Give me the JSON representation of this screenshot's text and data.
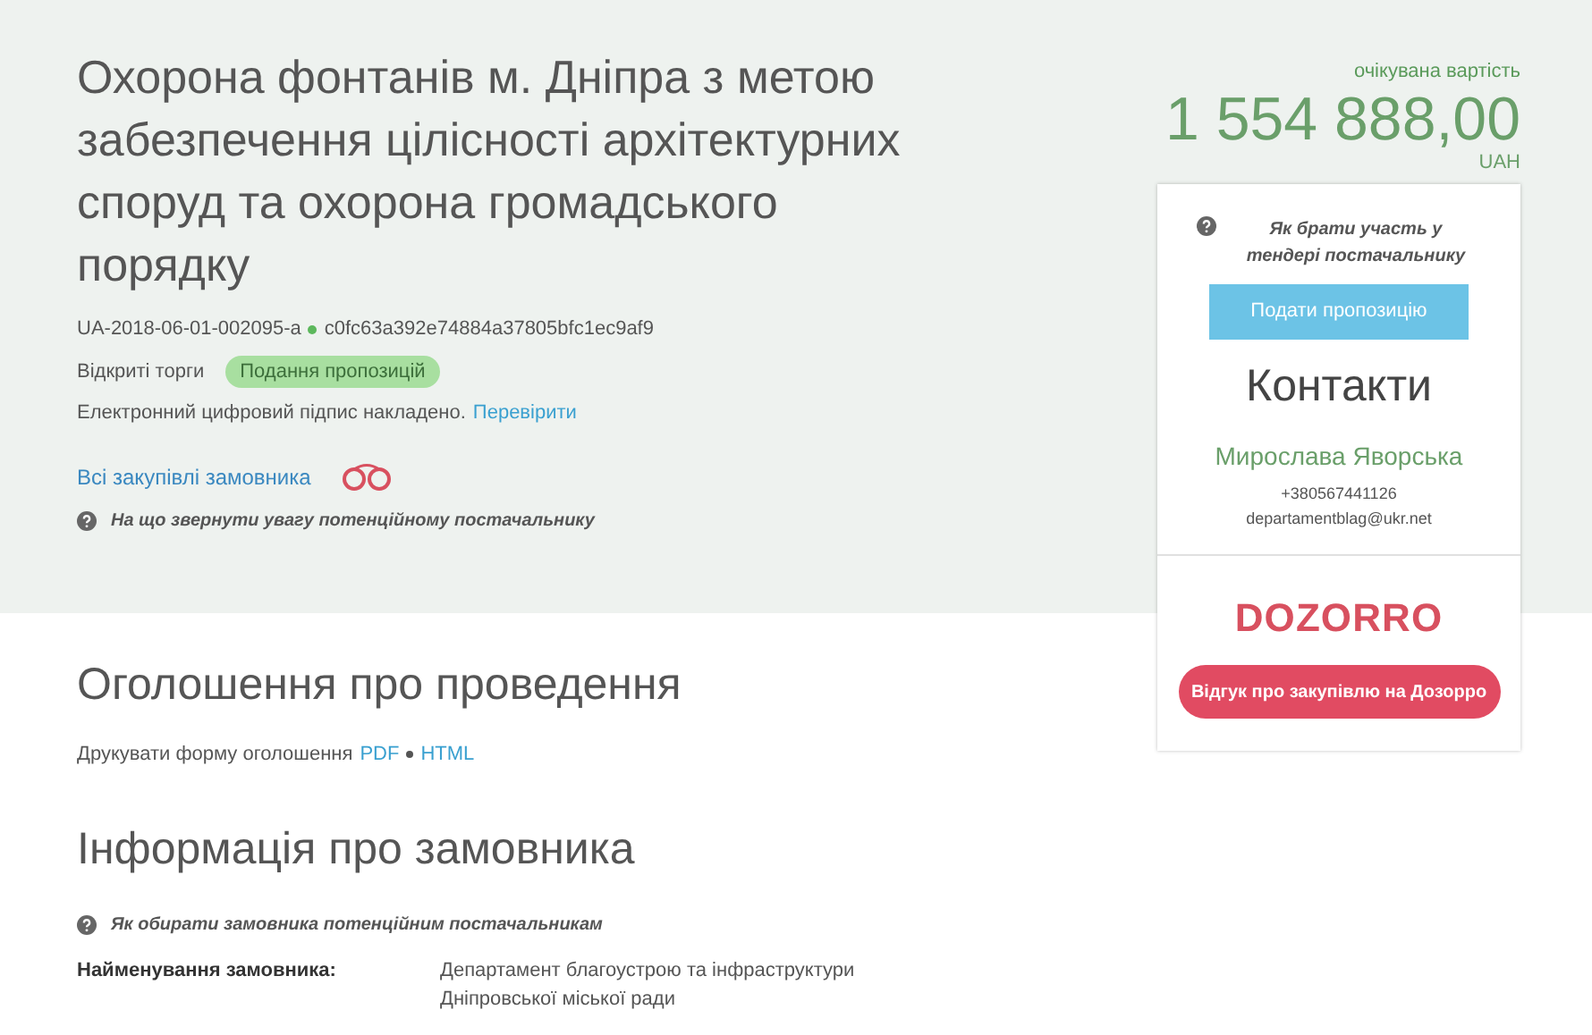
{
  "tender": {
    "title": "Охорона фонтанів м. Дніпра з метою забезпечення цілісності архітектурних споруд та охорона громадського порядку",
    "id": "UA-2018-06-01-002095-a",
    "hash": "c0fc63a392e74884a37805bfc1ec9af9",
    "procedure": "Відкриті торги",
    "status": "Подання пропозицій",
    "signature": "Електронний цифровий підпис накладено.",
    "signature_link": "Перевірити",
    "buyer_link": "Всі закупівлі замовника",
    "hint": "На що звернути увагу потенційному постачальнику"
  },
  "price": {
    "label": "очікувана вартість",
    "amount": "1 554 888,00",
    "currency": "UAH"
  },
  "card": {
    "hint": "Як брати участь у тендері постачальнику",
    "submit_button": "Подати пропозицію",
    "contacts_title": "Контакти",
    "contact_name": "Мирослава Яворська",
    "phone": "+380567441126",
    "email": "departamentblag@ukr.net",
    "logo": "DOZORRO",
    "feedback_button": "Відгук про закупівлю на Дозорро"
  },
  "announcement": {
    "title": "Оголошення про проведення",
    "print_label": "Друкувати форму оголошення",
    "links": [
      "PDF",
      "HTML"
    ]
  },
  "buyer": {
    "title": "Інформація про замовника",
    "hint": "Як обирати замовника потенційним постачальникам",
    "fields": [
      {
        "label": "Найменування замовника:",
        "value": "Департамент благоустрою та інфраструктури Дніпровської міської ради"
      }
    ]
  }
}
